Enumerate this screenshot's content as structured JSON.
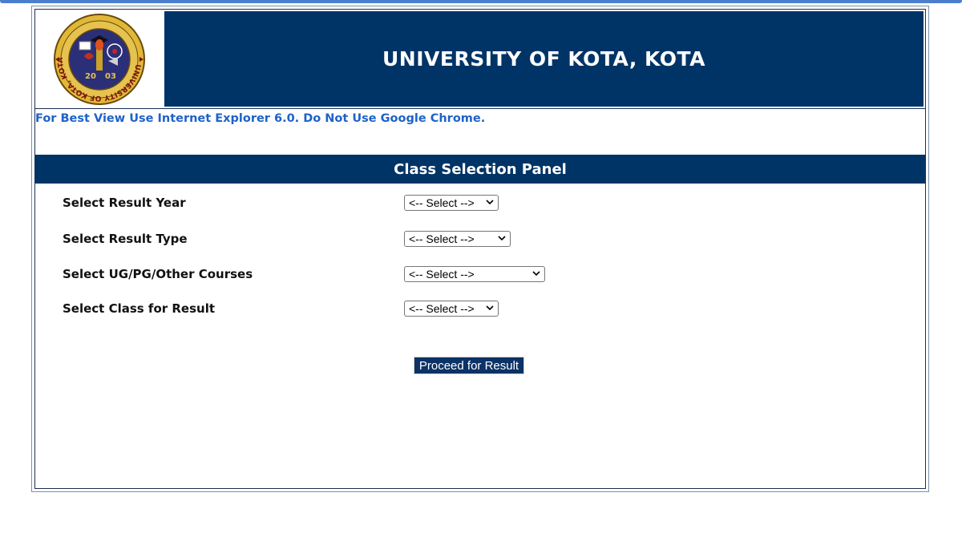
{
  "header": {
    "title": "UNIVERSITY OF KOTA, KOTA",
    "logo": {
      "year_left": "20",
      "year_right": "03",
      "ring_text": "UNIVERSITY OF KOTA, KOTA"
    }
  },
  "notice": "For Best View Use Internet Explorer 6.0. Do Not Use Google Chrome.",
  "panel": {
    "title": "Class Selection Panel"
  },
  "form": {
    "rows": [
      {
        "label": "Select Result Year",
        "selected": "<-- Select -->"
      },
      {
        "label": "Select Result Type",
        "selected": "<-- Select -->"
      },
      {
        "label": "Select UG/PG/Other Courses",
        "selected": "<-- Select -->"
      },
      {
        "label": "Select Class for Result",
        "selected": "<-- Select -->"
      }
    ],
    "submit_label": "Proceed for Result"
  },
  "colors": {
    "header_bg": "#003466",
    "notice_text": "#1e62c9"
  }
}
